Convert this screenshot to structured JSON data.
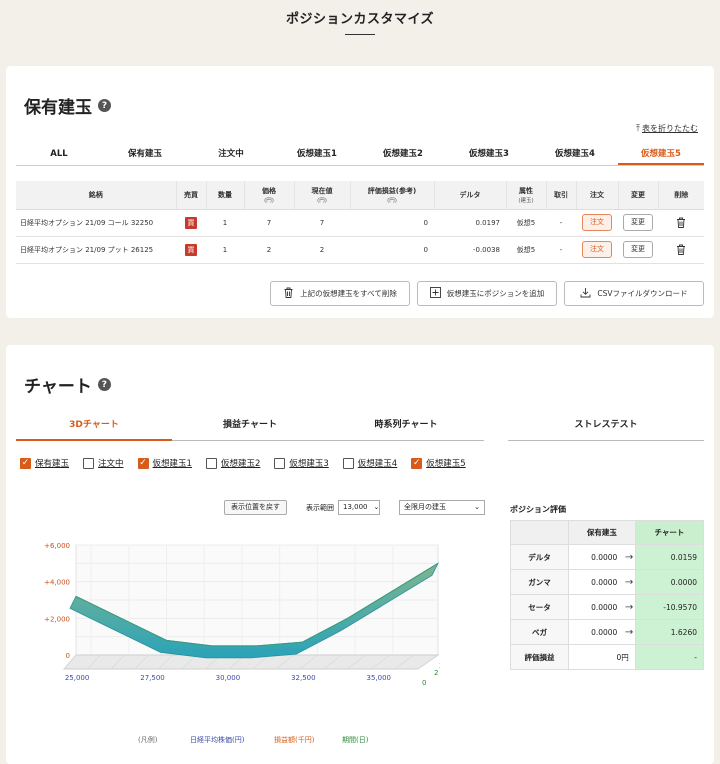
{
  "page_title": "ポジションカスタマイズ",
  "holdings": {
    "title": "保有建玉",
    "collapse_label": "表を折りたたむ",
    "tabs": [
      "ALL",
      "保有建玉",
      "注文中",
      "仮想建玉1",
      "仮想建玉2",
      "仮想建玉3",
      "仮想建玉4",
      "仮想建玉5"
    ],
    "active_tab": "仮想建玉5",
    "columns": {
      "name": "銘柄",
      "side": "売買",
      "qty": "数量",
      "price": "価格",
      "price_unit": "(円)",
      "current": "現在値",
      "current_unit": "(円)",
      "pl": "評価損益(参考)",
      "pl_unit": "(円)",
      "delta": "デルタ",
      "attr": "属性",
      "attr_sub": "(建玉)",
      "trade": "取引",
      "order": "注文",
      "change": "変更",
      "delete": "削除"
    },
    "rows": [
      {
        "name": "日経平均オプション 21/09 コール 32250",
        "side": "買",
        "qty": "1",
        "price": "7",
        "current": "7",
        "pl": "0",
        "delta": "0.0197",
        "attr": "仮想5",
        "trade": "-",
        "order": "注文",
        "change": "変更"
      },
      {
        "name": "日経平均オプション 21/09 プット 26125",
        "side": "買",
        "qty": "1",
        "price": "2",
        "current": "2",
        "pl": "0",
        "delta": "-0.0038",
        "attr": "仮想5",
        "trade": "-",
        "order": "注文",
        "change": "変更"
      }
    ],
    "actions": {
      "delete_all": "上記の仮想建玉をすべて削除",
      "add": "仮想建玉にポジションを追加",
      "csv": "CSVファイルダウンロード"
    }
  },
  "chart": {
    "title": "チャート",
    "tabs": [
      "3Dチャート",
      "損益チャート",
      "時系列チャート",
      "ストレステスト"
    ],
    "active_tab": "3Dチャート",
    "checkboxes": [
      {
        "label": "保有建玉",
        "checked": true
      },
      {
        "label": "注文中",
        "checked": false
      },
      {
        "label": "仮想建玉1",
        "checked": true
      },
      {
        "label": "仮想建玉2",
        "checked": false
      },
      {
        "label": "仮想建玉3",
        "checked": false
      },
      {
        "label": "仮想建玉4",
        "checked": false
      },
      {
        "label": "仮想建玉5",
        "checked": true
      }
    ],
    "reset_view": "表示位置を戻す",
    "range_label": "表示範囲",
    "range_value": "13,000",
    "month_value": "全限月の建玉",
    "legend": {
      "prefix": "(凡例)",
      "x": "日経平均株価(円)",
      "y": "損益額(千円)",
      "z": "期間(日)"
    },
    "accent": "#d95b1a"
  },
  "chart_data": {
    "type": "area",
    "subtype": "3d-surface",
    "x_ticks": [
      "25,000",
      "27,500",
      "30,000",
      "32,500",
      "35,000"
    ],
    "y_ticks": [
      "0",
      "+2,000",
      "+4,000",
      "+6,000"
    ],
    "z_ticks": [
      "0",
      "2",
      "3"
    ],
    "xlabel": "日経平均株価(円)",
    "ylabel": "損益額(千円)",
    "zlabel": "期間(日)",
    "ylim": [
      0,
      6000
    ],
    "series": [
      {
        "x": [
          24500,
          26000,
          27500,
          29000,
          30500,
          32000,
          33500,
          35000,
          36500
        ],
        "values": [
          3200,
          2000,
          800,
          500,
          500,
          700,
          2000,
          3500,
          5000
        ]
      }
    ]
  },
  "evaluation": {
    "title": "ポジション評価",
    "col_holdings": "保有建玉",
    "col_chart": "チャート",
    "rows": [
      {
        "label": "デルタ",
        "holding": "0.0000",
        "chart": "0.0159"
      },
      {
        "label": "ガンマ",
        "holding": "0.0000",
        "chart": "0.0000"
      },
      {
        "label": "セータ",
        "holding": "0.0000",
        "chart": "-10.9570"
      },
      {
        "label": "ベガ",
        "holding": "0.0000",
        "chart": "1.6260"
      }
    ],
    "pl_label": "評価損益",
    "pl_holding": "0円",
    "pl_chart": "-"
  }
}
